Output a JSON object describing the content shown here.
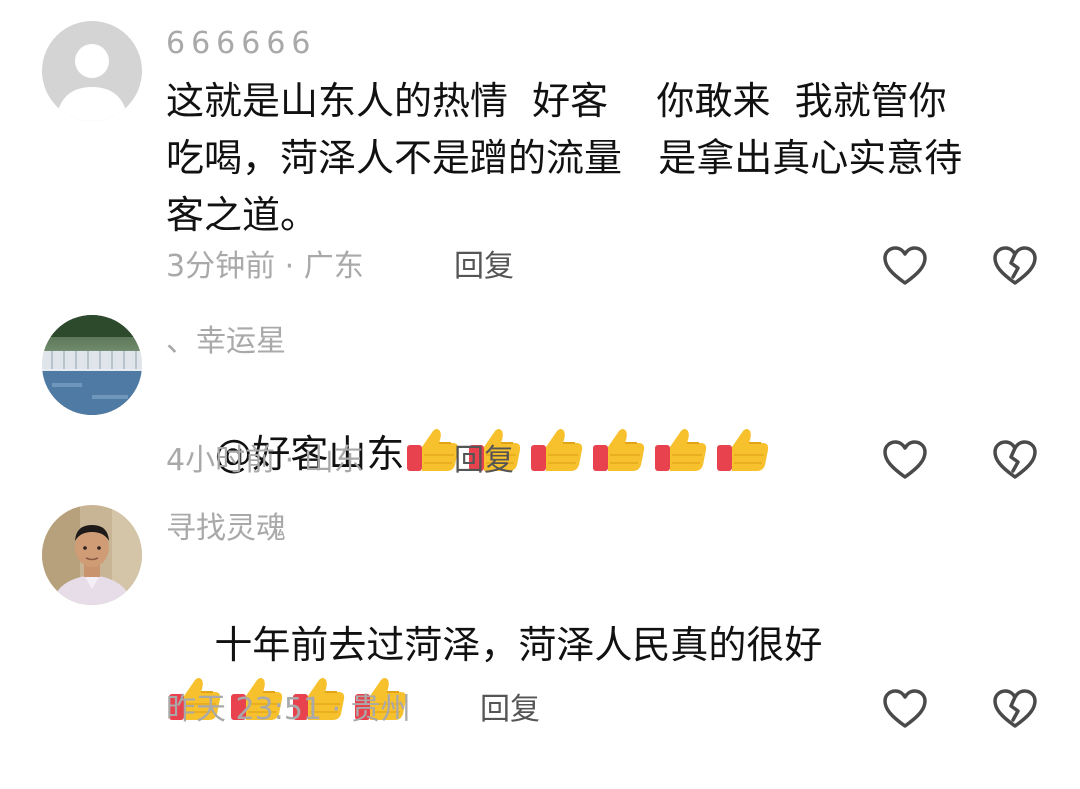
{
  "colors": {
    "secondary_text": "#a9a9a9",
    "reply_text": "#555555",
    "primary_text": "#111111",
    "icon_stroke": "#4a4a4a"
  },
  "comments": [
    {
      "username": "666666",
      "text": "这就是山东人的热情  好客    你敢来  我就管你\n吃喝，菏泽人不是蹭的流量   是拿出真心实意待\n客之道。",
      "thumbs_count": 0,
      "meta": "3分钟前 · 广东",
      "reply_label": "回复",
      "avatar": "default-avatar-icon"
    },
    {
      "username": "、幸运星",
      "text": "@好客山东",
      "thumbs_count": 6,
      "meta": "4小时前 · 山东",
      "reply_label": "回复",
      "avatar": "waterfall-photo"
    },
    {
      "username": "寻找灵魂",
      "text": "十年前去过菏泽，菏泽人民真的很好",
      "thumbs_count": 4,
      "meta": "昨天 23:51 · 贵州",
      "reply_label": "回复",
      "avatar": "man-portrait-photo"
    }
  ],
  "icons": {
    "like": "heart-outline-icon",
    "dislike": "broken-heart-icon",
    "reaction_emoji": "thumbs-up-emoji"
  }
}
